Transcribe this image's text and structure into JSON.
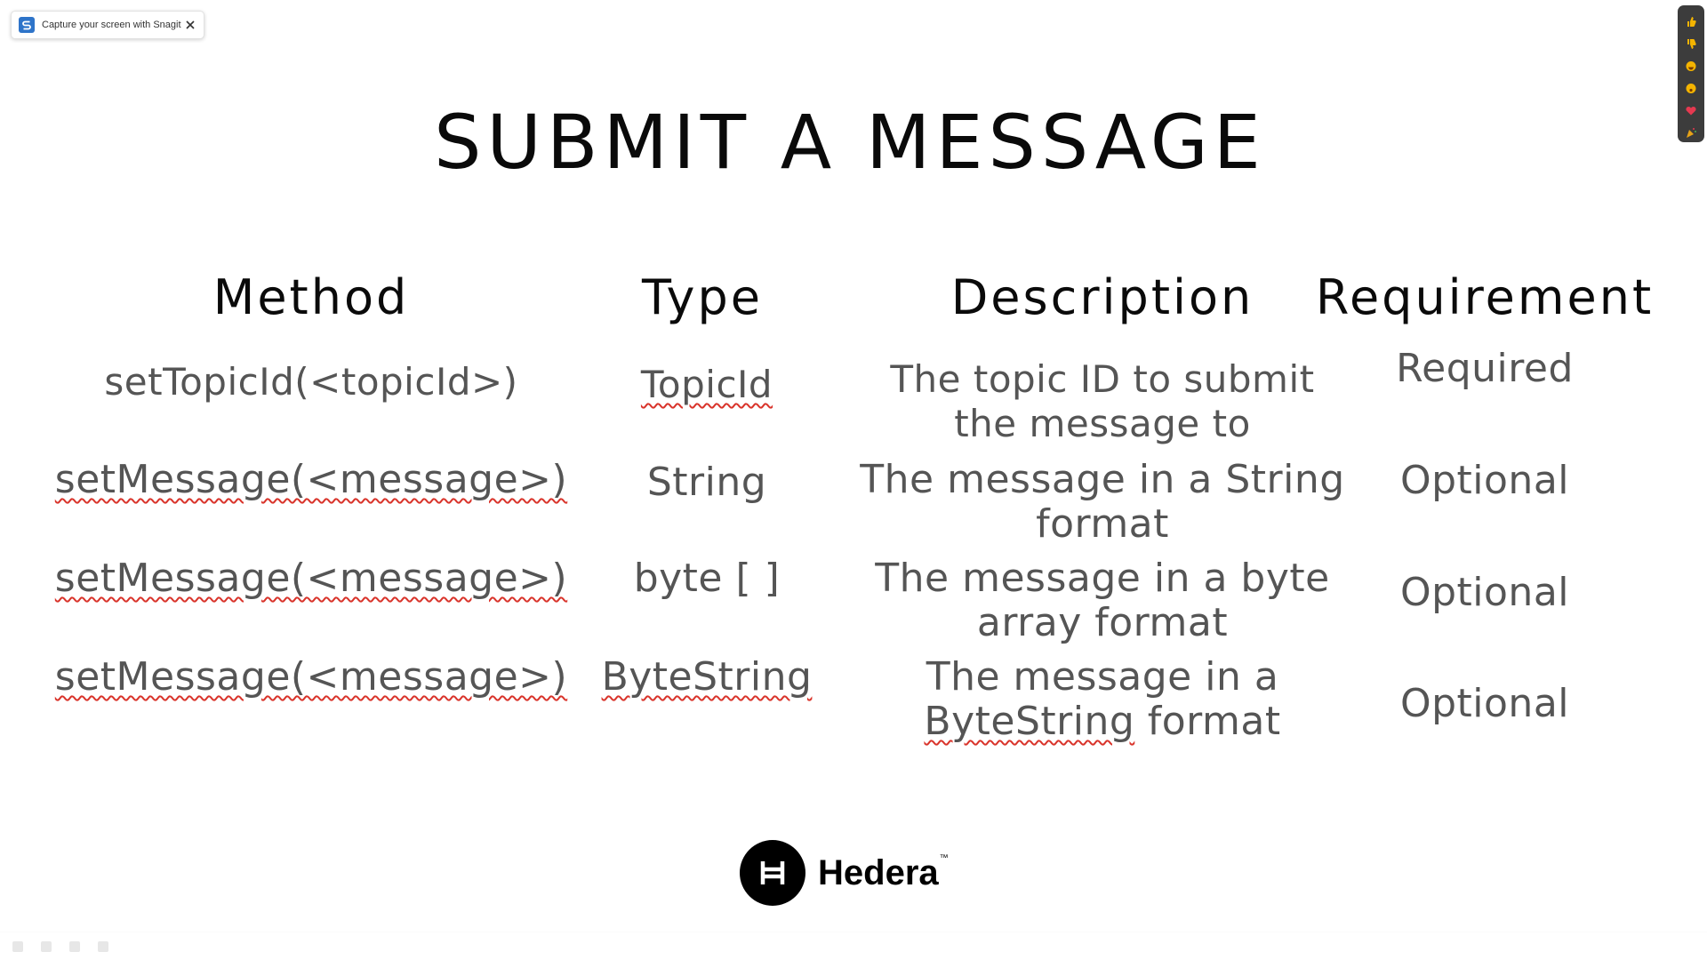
{
  "snagit": {
    "message": "Capture your screen with Snagit",
    "logo_icon": "snagit-s-icon",
    "close_icon": "close-icon"
  },
  "reactions": [
    "thumbs-up-icon",
    "thumbs-down-icon",
    "laugh-icon",
    "surprised-icon",
    "heart-icon",
    "celebrate-icon"
  ],
  "slide": {
    "title": "SUBMIT A MESSAGE",
    "headers": {
      "method": "Method",
      "type": "Type",
      "description": "Description",
      "requirement": "Requirement"
    },
    "rows": [
      {
        "method": "setTopicId(<topicId>)",
        "type": "TopicId",
        "description_line1": "The topic ID to submit",
        "description_line2": "the message to",
        "requirement": "Required"
      },
      {
        "method": "setMessage(<message>)",
        "type": "String",
        "description_line1": "The message in a String",
        "description_line2": "format",
        "requirement": "Optional"
      },
      {
        "method": "setMessage(<message>)",
        "type": "byte [ ]",
        "description_line1": "The message in a byte",
        "description_line2": "array format",
        "requirement": "Optional"
      },
      {
        "method": "setMessage(<message>)",
        "type": "ByteString",
        "description_line1": "The message in a",
        "description_line2": "ByteString format",
        "requirement": "Optional"
      }
    ]
  },
  "brand": {
    "name": "Hedera",
    "trademark": "™",
    "mark_icon": "hedera-h-icon"
  },
  "colors": {
    "spellcheck": "#d9342b",
    "cell_text": "#555555",
    "snagit_blue": "#2e74c9",
    "reaction_bar": "#3c3c3c"
  }
}
